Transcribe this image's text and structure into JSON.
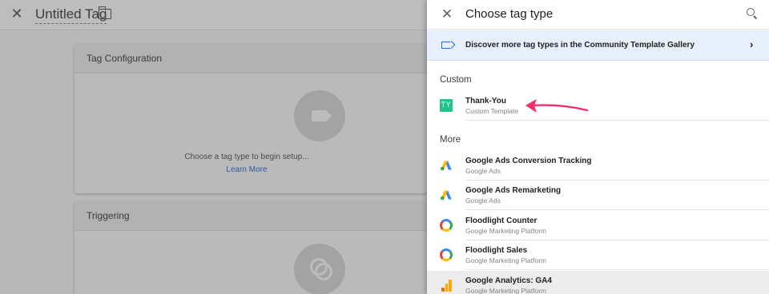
{
  "editor": {
    "close_icon": "close-icon",
    "title": "Untitled Tag",
    "folder_icon": "folder-icon",
    "config_card": {
      "title": "Tag Configuration",
      "hint": "Choose a tag type to begin setup...",
      "link": "Learn More"
    },
    "trigger_card": {
      "title": "Triggering"
    }
  },
  "panel": {
    "title": "Choose tag type",
    "banner": {
      "text": "Discover more tag types in the Community Template Gallery"
    },
    "custom_label": "Custom",
    "custom_items": [
      {
        "name": "Thank-You",
        "sub": "Custom Template",
        "icon_text": "TY",
        "icon_color": "#20c58a"
      }
    ],
    "more_label": "More",
    "more_items": [
      {
        "name": "Google Ads Conversion Tracking",
        "sub": "Google Ads",
        "icon": "google-ads-icon"
      },
      {
        "name": "Google Ads Remarketing",
        "sub": "Google Ads",
        "icon": "google-ads-icon"
      },
      {
        "name": "Floodlight Counter",
        "sub": "Google Marketing Platform",
        "icon": "floodlight-icon"
      },
      {
        "name": "Floodlight Sales",
        "sub": "Google Marketing Platform",
        "icon": "floodlight-icon"
      },
      {
        "name": "Google Analytics: GA4",
        "sub": "Google Marketing Platform",
        "icon": "google-analytics-icon"
      }
    ]
  },
  "annotation": {
    "arrow_color": "#f0306a"
  }
}
